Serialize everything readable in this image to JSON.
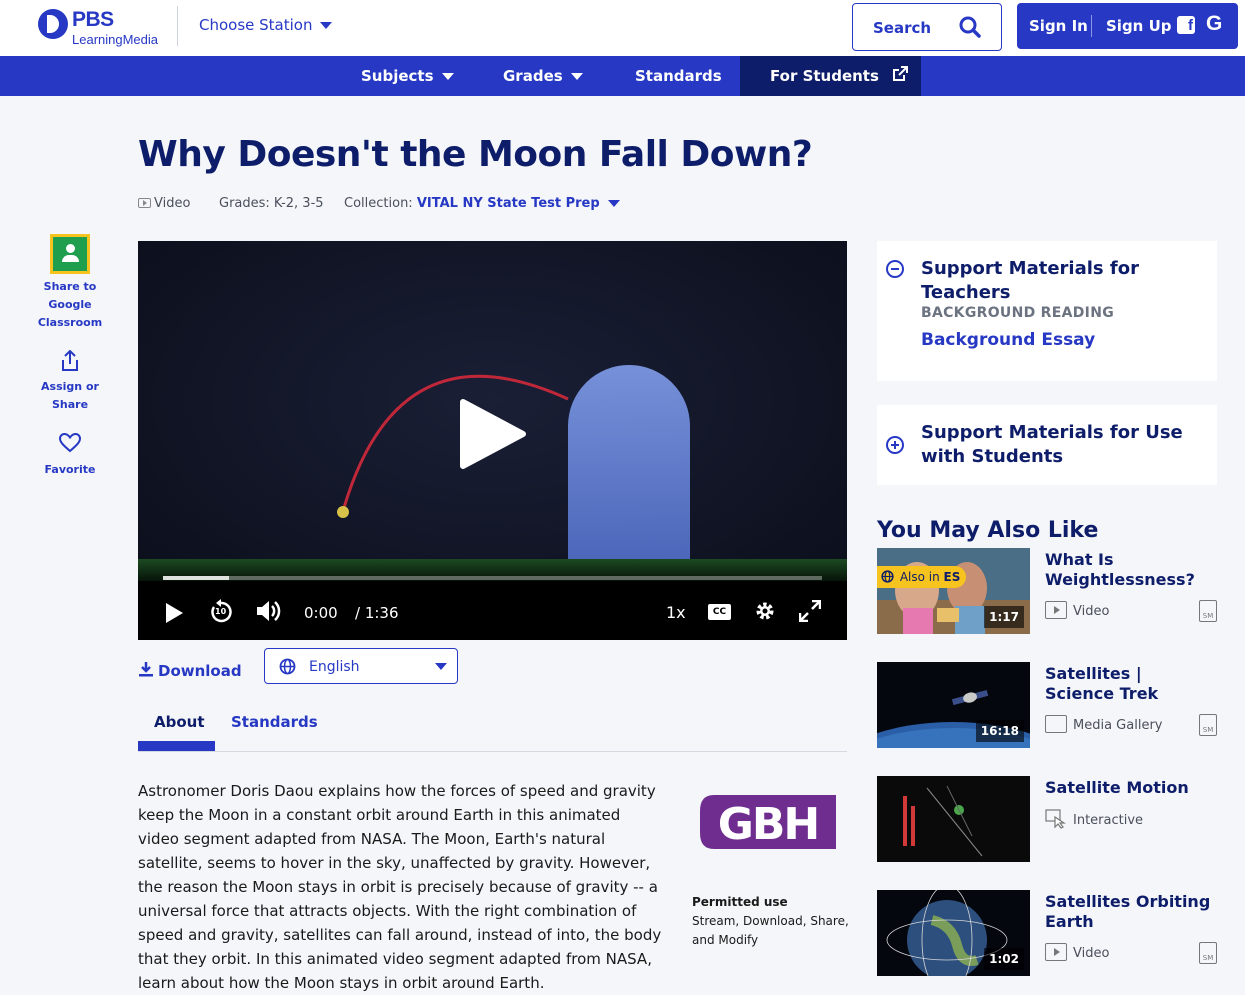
{
  "header": {
    "logo_brand": "PBS",
    "logo_sub": "LearningMedia",
    "station_label": "Choose Station",
    "search_label": "Search",
    "sign_in": "Sign In",
    "sign_up": "Sign Up",
    "facebook_glyph": "f",
    "google_glyph": "G"
  },
  "nav": {
    "subjects": "Subjects",
    "grades": "Grades",
    "standards": "Standards",
    "for_students": "For Students"
  },
  "page": {
    "title": "Why Doesn't the Moon Fall Down?",
    "media_type": "Video",
    "grades": "Grades: K-2, 3-5",
    "collection_label": "Collection:",
    "collection_value": "VITAL NY State Test Prep"
  },
  "sidebar": {
    "share_classroom": "Share to Google Classroom",
    "assign_share": "Assign or Share",
    "favorite": "Favorite"
  },
  "player": {
    "current_time": "0:00",
    "duration": "/ 1:36",
    "speed": "1x",
    "cc": "CC",
    "progress_fraction": 0.1,
    "rewind_seconds": "10"
  },
  "actions": {
    "download": "Download",
    "language": "English"
  },
  "tabs": {
    "about": "About",
    "standards": "Standards"
  },
  "about": {
    "description": "Astronomer Doris Daou explains how the forces of speed and gravity keep the Moon in a constant orbit around Earth in this animated video segment adapted from NASA. The Moon, Earth's natural satellite, seems to hover in the sky, unaffected by gravity. However, the reason the Moon stays in orbit is precisely because of gravity -- a universal force that attracts objects. With the right combination of speed and gravity, satellites can fall around, instead of into, the body that they orbit. In this animated video segment adapted from NASA, learn about how the Moon stays in orbit around Earth.",
    "partner_logo": "GBH",
    "permitted_use_title": "Permitted use",
    "permitted_use_line1": "Stream, Download, Share,",
    "permitted_use_line2": "and Modify"
  },
  "support": {
    "teachers_title": "Support Materials for Teachers",
    "background_reading_label": "BACKGROUND READING",
    "background_essay": "Background Essay",
    "students_title": "Support Materials for Use with Students"
  },
  "recommendations": {
    "heading": "You May Also Like",
    "items": [
      {
        "title": "What Is Weightlessness?",
        "type": "Video",
        "duration": "1:17",
        "badge_prefix": "Also in",
        "badge_lang": "ES",
        "sm": "SM"
      },
      {
        "title": "Satellites | Science Trek",
        "type": "Media Gallery",
        "duration": "16:18",
        "sm": "SM"
      },
      {
        "title": "Satellite Motion",
        "type": "Interactive"
      },
      {
        "title": "Satellites Orbiting Earth",
        "type": "Video",
        "duration": "1:02",
        "sm": "SM"
      }
    ]
  },
  "colors": {
    "brand_blue": "#2638c4",
    "navy": "#0e1d6a",
    "accent_yellow": "#f7c31e"
  }
}
